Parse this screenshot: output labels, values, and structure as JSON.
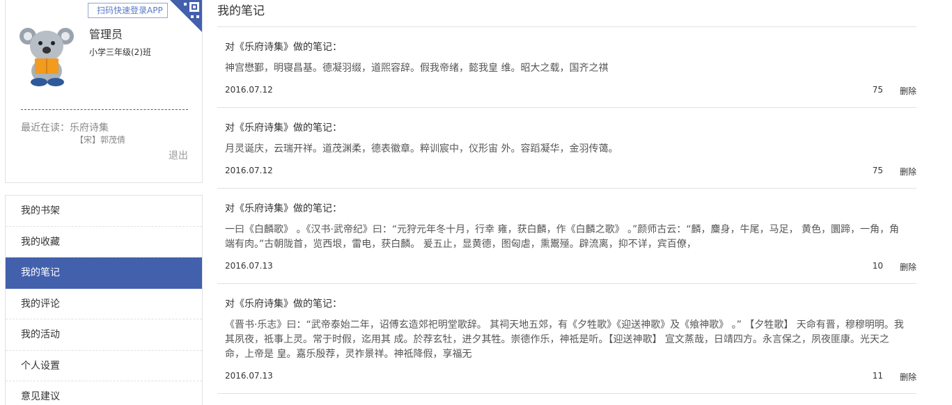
{
  "profile": {
    "qr_label": "扫码快速登录APP",
    "name": "管理员",
    "class": "小学三年级(2)班",
    "recent_reading": "最近在读：乐府诗集",
    "recent_author": "【宋】郭茂倩",
    "logout": "退出",
    "accent": "#4360ad"
  },
  "nav": {
    "items": [
      {
        "label": "我的书架"
      },
      {
        "label": "我的收藏"
      },
      {
        "label": "我的笔记"
      },
      {
        "label": "我的评论"
      },
      {
        "label": "我的活动"
      },
      {
        "label": "个人设置"
      },
      {
        "label": "意见建议"
      }
    ],
    "active_index": 2
  },
  "main": {
    "title": "我的笔记",
    "notes": [
      {
        "heading": "对《乐府诗集》做的笔记：",
        "text": "神宫懋鄞，明寝昌基。德凝羽缀，道煕容辞。假我帝绪，懿我皇 维。昭大之载，国齐之祺",
        "date": "2016.07.12",
        "count": "75",
        "delete": "删除"
      },
      {
        "heading": "对《乐府诗集》做的笔记：",
        "text": "月灵诞庆，云瑞开祥。道茂渊柔，德表徽章。粹训宸中，仪形宙 外。容蹈凝华，金羽传蔼。",
        "date": "2016.07.12",
        "count": "75",
        "delete": "删除"
      },
      {
        "heading": "对《乐府诗集》做的笔记：",
        "text": "一曰《白麟歌》 。《汉书·武帝纪》曰：“元狩元年冬十月，行幸 雍，获白麟，作《白麟之歌》 。”颜师古云：“麟，麋身，牛尾，马足， 黄色，圜蹄，一角，角端有肉。”古朝陇首，览西垠，雷电，获白麟。 爰五止，显黄德，图匈虐，熏鬻殛。辟流离，抑不详，宾百僚，",
        "date": "2016.07.13",
        "count": "10",
        "delete": "删除"
      },
      {
        "heading": "对《乐府诗集》做的笔记：",
        "text": "《晋书·乐志》曰：“武帝泰始二年，诏傅玄造郊祀明堂歌辞。 其祠天地五郊，有《夕牲歌》《迎送神歌》及《飨神歌》 。” 【夕牲歌】 天命有晋，穆穆明明。我其夙夜，祗事上灵。常于时假，迄用其 成。於荐玄牡，进夕其牲。崇德作乐，神祗是听。【迎送神歌】 宣文蒸哉，日靖四方。永言保之，夙夜匪康。光天之命，上帝是 皇。嘉乐殷荐，灵祚景祥。神祗降假，享福无",
        "date": "2016.07.13",
        "count": "11",
        "delete": "删除"
      }
    ]
  }
}
